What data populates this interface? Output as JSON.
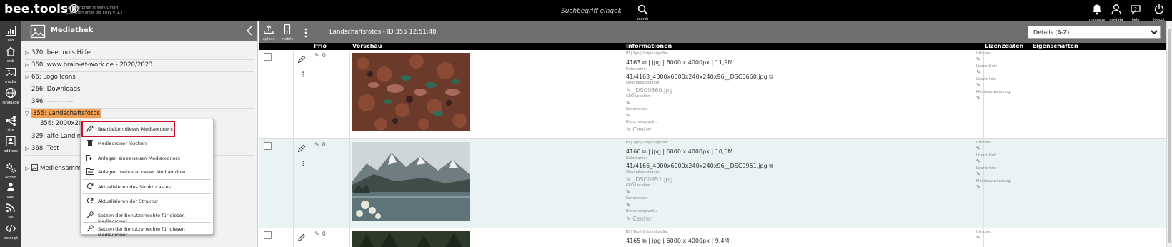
{
  "app": {
    "brand": "bee.tools®",
    "brand_sub_line1": "Urheber brain at work GmbH",
    "brand_sub_line2": "Lizenziert unter der EUPL v. 1.2"
  },
  "search": {
    "placeholder": "Suchbegriff eingeben",
    "button_label": "search"
  },
  "top_actions": [
    {
      "label": "message",
      "icon": "bell-icon"
    },
    {
      "label": "mydata",
      "icon": "user-icon"
    },
    {
      "label": "help",
      "icon": "chat-help-icon"
    },
    {
      "label": "logout",
      "icon": "power-icon"
    }
  ],
  "rail": [
    {
      "label": "seo",
      "icon": "chart-icon"
    },
    {
      "label": "web",
      "icon": "home-icon"
    },
    {
      "label": "media",
      "icon": "image-icon"
    },
    {
      "label": "language",
      "icon": "globe-icon"
    },
    {
      "label": "site",
      "icon": "sitemap-icon"
    },
    {
      "label": "address",
      "icon": "contact-card-icon"
    },
    {
      "label": "admin",
      "icon": "gears-icon"
    },
    {
      "label": "user",
      "icon": "users-icon"
    },
    {
      "label": "rss",
      "icon": "rss-icon"
    },
    {
      "label": "bescript",
      "icon": "code-icon"
    }
  ],
  "tree": {
    "title": "Mediathek",
    "items": [
      {
        "label": "370: bee.tools Hilfe",
        "expandable": true
      },
      {
        "label": "360: www.brain-at-work.de - 2020/2023",
        "expandable": true
      },
      {
        "label": "66: Logo Icons",
        "expandable": true
      },
      {
        "label": "266: Downloads",
        "expandable": false
      },
      {
        "label": "346: ------------",
        "expandable": false
      },
      {
        "label": "355: Landschaftsfotos",
        "expandable": true,
        "selected": true
      },
      {
        "label": "356: 2000x200",
        "expandable": false
      },
      {
        "label": "329: alte Landing",
        "expandable": false
      },
      {
        "label": "368: Test",
        "expandable": true
      },
      {
        "label": "Mediensamm",
        "expandable": true
      }
    ]
  },
  "context_menu": {
    "items": [
      {
        "label": "Bearbeiten dieses Mediaordners",
        "icon": "pencil-icon"
      },
      {
        "label": "Mediaordner löschen",
        "icon": "trash-icon"
      },
      {
        "label": "Anlegen eines neuen Mediaordners",
        "icon": "folder-add-icon"
      },
      {
        "label": "Anlegen mehrerer neuer Mediaordner",
        "icon": "folders-add-icon"
      },
      {
        "label": "Aktualisieren des Strukturastes",
        "icon": "refresh-icon"
      },
      {
        "label": "Aktualisieren der Struktur",
        "icon": "refresh-icon"
      },
      {
        "label": "Setzen der Benutzerrechte für diesen Mediaordner",
        "icon": "key-icon"
      },
      {
        "label": "Setzen der Benutzerrechte für diesen Mediaordner",
        "icon": "key-icon"
      }
    ]
  },
  "toolbar": {
    "upload_label": "upload",
    "mobile_label": "mobile",
    "title": "Landschaftsfotos - ID 355 12:51:48",
    "sort_selected": "Details (A-Z)"
  },
  "grid": {
    "headers": {
      "prio": "Prio",
      "preview": "Vorschau",
      "info": "Informationen",
      "license": "Lizenzdaten + Eigenschaften"
    },
    "info_keys": {
      "id_type": "ID | Typ | Originalgröße:",
      "filename": "Dateiname:",
      "original_filename": "Originaldateiname:",
      "geo": "GEO-Location:",
      "comment": "Kommentar:",
      "focus": "Bildschwerpunkt:"
    },
    "license_keys": {
      "author": "Urheber:",
      "license_link": "Lizenz-Link:",
      "license_info": "Lizenz-Info:",
      "usage": "Medienanwendung:"
    },
    "rows": [
      {
        "prio": "0",
        "id": "4163",
        "meta": "| jpg | 6000 x 4000px | 11,9M",
        "filename": "41/4163_4000x6000x240x240x96__DSC0660.jpg",
        "original": "_DSC0660.jpg",
        "focus": "Center",
        "image": "autumn-leaves-photo"
      },
      {
        "prio": "0",
        "id": "4166",
        "meta": "| jpg | 6000 x 4000px | 10,5M",
        "filename": "41/4166_4000x6000x240x240x96__DSC0951.jpg",
        "original": "_DSC0951.jpg",
        "focus": "Center",
        "image": "mountain-lake-photo"
      },
      {
        "prio": "0",
        "id": "4165",
        "meta": "| jpg | 6000 x 4000px | 9,4M",
        "image": "forest-photo"
      }
    ]
  }
}
